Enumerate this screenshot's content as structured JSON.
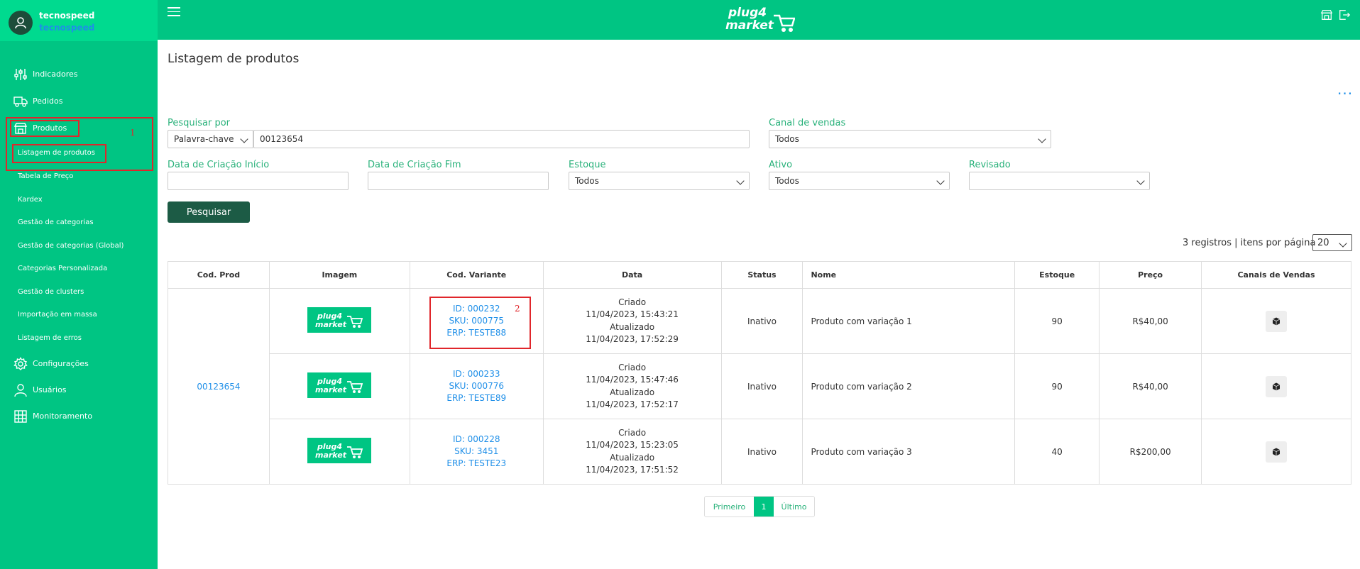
{
  "user": {
    "name": "tecnospeed",
    "company": "tecnospeed"
  },
  "sidebar": {
    "items": [
      {
        "label": "Indicadores",
        "icon": "sliders-icon"
      },
      {
        "label": "Pedidos",
        "icon": "truck-icon"
      },
      {
        "label": "Produtos",
        "icon": "store-icon"
      },
      {
        "label": "Configurações",
        "icon": "gear-icon"
      },
      {
        "label": "Usuários",
        "icon": "user-icon"
      },
      {
        "label": "Monitoramento",
        "icon": "monitor-grid-icon"
      }
    ],
    "subitems": [
      "Listagem de produtos",
      "Tabela de Preço",
      "Kardex",
      "Gestão de categorias",
      "Gestão de categorias (Global)",
      "Categorias Personalizada",
      "Gestão de clusters",
      "Importação em massa",
      "Listagem de erros"
    ]
  },
  "annotations": {
    "n1": "1",
    "n2": "2"
  },
  "brand": {
    "logo_line1": "plug4",
    "logo_line2": "market"
  },
  "page": {
    "title": "Listagem de produtos",
    "more": "···"
  },
  "filters": {
    "search_by_label": "Pesquisar por",
    "search_by_value": "Palavra-chave",
    "search_value": "00123654",
    "channel_label": "Canal de vendas",
    "channel_value": "Todos",
    "created_start_label": "Data de Criação Início",
    "created_end_label": "Data de Criação Fim",
    "stock_label": "Estoque",
    "stock_value": "Todos",
    "active_label": "Ativo",
    "active_value": "Todos",
    "reviewed_label": "Revisado",
    "reviewed_value": "",
    "search_button": "Pesquisar"
  },
  "results": {
    "summary": "3 registros | itens por página",
    "per_page": "20"
  },
  "table": {
    "headers": [
      "Cod. Prod",
      "Imagem",
      "Cod. Variante",
      "Data",
      "Status",
      "Nome",
      "Estoque",
      "Preço",
      "Canais de Vendas"
    ],
    "product_code": "00123654",
    "rows": [
      {
        "id": "ID: 000232",
        "sku": "SKU: 000775",
        "erp": "ERP: TESTE88",
        "created_label": "Criado",
        "created": "11/04/2023, 15:43:21",
        "updated_label": "Atualizado",
        "updated": "11/04/2023, 17:52:29",
        "status": "Inativo",
        "name": "Produto com variação 1",
        "stock": "90",
        "price": "R$40,00"
      },
      {
        "id": "ID: 000233",
        "sku": "SKU: 000776",
        "erp": "ERP: TESTE89",
        "created_label": "Criado",
        "created": "11/04/2023, 15:47:46",
        "updated_label": "Atualizado",
        "updated": "11/04/2023, 17:52:17",
        "status": "Inativo",
        "name": "Produto com variação 2",
        "stock": "90",
        "price": "R$40,00"
      },
      {
        "id": "ID: 000228",
        "sku": "SKU: 3451",
        "erp": "ERP: TESTE23",
        "created_label": "Criado",
        "created": "11/04/2023, 15:23:05",
        "updated_label": "Atualizado",
        "updated": "11/04/2023, 17:51:52",
        "status": "Inativo",
        "name": "Produto com variação 3",
        "stock": "40",
        "price": "R$200,00"
      }
    ]
  },
  "pagination": {
    "first": "Primeiro",
    "current": "1",
    "last": "Último"
  }
}
